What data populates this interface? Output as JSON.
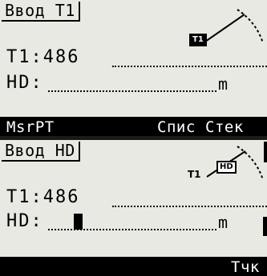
{
  "screen1": {
    "title": "Ввод T1",
    "row1_label": "T1:",
    "row1_value": "486",
    "row2_label": "HD:",
    "unit": "m",
    "diagram_tag": "T1",
    "softkeys": [
      "MsrPT",
      "Спис",
      "Стек"
    ]
  },
  "screen2": {
    "title": "Ввод HD",
    "row1_label": "T1:",
    "row1_value": "486",
    "row2_label": "HD:",
    "unit": "m",
    "diagram_t1": "T1",
    "diagram_tag": "HD",
    "softkeys": [
      "Тчк"
    ]
  }
}
